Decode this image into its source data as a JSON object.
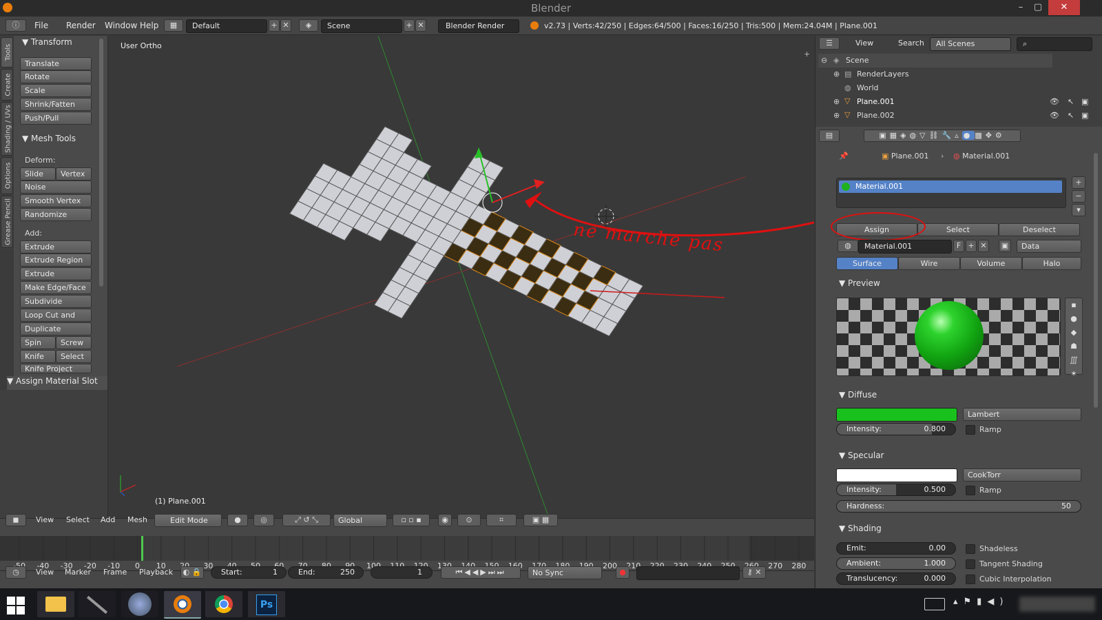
{
  "window": {
    "title": "Blender",
    "min": "–",
    "max": "▢",
    "close": "✕"
  },
  "topbar": {
    "menus": [
      "File",
      "Render",
      "Window",
      "Help"
    ],
    "layout": "Default",
    "scene": "Scene",
    "engine": "Blender Render",
    "stats": "v2.73 | Verts:42/250 | Edges:64/500 | Faces:16/250 | Tris:500 | Mem:24.04M | Plane.001"
  },
  "tooltabs": [
    "Tools",
    "Create",
    "Shading / UVs",
    "Options",
    "Grease Pencil"
  ],
  "toolshelf": {
    "transform": {
      "title": "Transform",
      "buttons": [
        "Translate",
        "Rotate",
        "Scale",
        "Shrink/Fatten",
        "Push/Pull"
      ]
    },
    "meshtools": {
      "title": "Mesh Tools",
      "deform_label": "Deform:",
      "slide_edge": "Slide Ed",
      "vertex": "Vertex",
      "deform_buttons": [
        "Noise",
        "Smooth Vertex",
        "Randomize"
      ],
      "add_label": "Add:",
      "extrude": "Extrude",
      "add_buttons": [
        "Extrude Region",
        "Extrude Individual",
        "Make Edge/Face",
        "Subdivide",
        "Loop Cut and Slide",
        "Duplicate"
      ],
      "spin": "Spin",
      "screw": "Screw",
      "knife": "Knife",
      "select": "Select",
      "knife_project": "Knife Project"
    },
    "assign_slot": "Assign Material Slot"
  },
  "viewport": {
    "view_label": "User Ortho",
    "object_label": "(1) Plane.001",
    "annotation": "ne marche pas",
    "annotation_color": "#e01010"
  },
  "view_header": {
    "menus": [
      "View",
      "Select",
      "Add",
      "Mesh"
    ],
    "mode": "Edit Mode",
    "orientation": "Global"
  },
  "timeline": {
    "ticks": [
      "-50",
      "-40",
      "-30",
      "-20",
      "-10",
      "0",
      "10",
      "20",
      "30",
      "40",
      "50",
      "60",
      "70",
      "80",
      "90",
      "100",
      "110",
      "120",
      "130",
      "140",
      "150",
      "160",
      "170",
      "180",
      "190",
      "200",
      "210",
      "220",
      "230",
      "240",
      "250",
      "260",
      "270",
      "280"
    ],
    "current_frame": 1
  },
  "timeline_header": {
    "menus": [
      "View",
      "Marker",
      "Frame",
      "Playback"
    ],
    "start_label": "Start:",
    "start": "1",
    "end_label": "End:",
    "end": "250",
    "current": "1",
    "sync": "No Sync"
  },
  "outliner": {
    "menus": [
      "View",
      "Search"
    ],
    "filter": "All Scenes",
    "items": [
      "Scene",
      "RenderLayers",
      "World",
      "Plane.001",
      "Plane.002"
    ]
  },
  "properties": {
    "breadcrumb_object": "Plane.001",
    "breadcrumb_material": "Material.001",
    "slot": "Material.001",
    "assign": "Assign",
    "select": "Select",
    "deselect": "Deselect",
    "material_name": "Material.001",
    "fake_user": "F",
    "link": "Data",
    "tabs": [
      "Surface",
      "Wire",
      "Volume",
      "Halo"
    ],
    "preview_title": "Preview",
    "diffuse": {
      "title": "Diffuse",
      "color": "#19c11c",
      "shader": "Lambert",
      "intensity_label": "Intensity:",
      "intensity": "0.800",
      "intensity_value": 0.8,
      "ramp": "Ramp"
    },
    "specular": {
      "title": "Specular",
      "color": "#ffffff",
      "shader": "CookTorr",
      "intensity_label": "Intensity:",
      "intensity": "0.500",
      "intensity_value": 0.5,
      "ramp": "Ramp",
      "hardness_label": "Hardness:",
      "hardness": "50"
    },
    "shading": {
      "title": "Shading",
      "emit_label": "Emit:",
      "emit": "0.00",
      "ambient_label": "Ambient:",
      "ambient": "1.000",
      "translucency_label": "Translucency:",
      "translucency": "0.000",
      "shadeless": "Shadeless",
      "tangent": "Tangent Shading",
      "cubic": "Cubic Interpolation"
    }
  },
  "taskbar": {
    "apps": [
      "windows-start",
      "file-explorer",
      "pen-tool",
      "blurred-app",
      "blender",
      "chrome",
      "photoshop"
    ],
    "ps": "Ps"
  }
}
